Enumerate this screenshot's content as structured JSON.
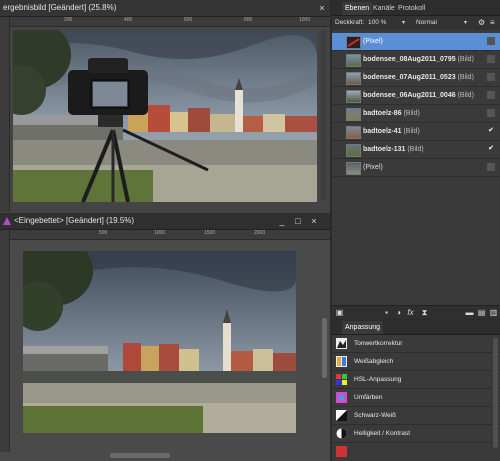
{
  "doc1": {
    "title": "ergebnisbild [Geändert] (25.8%)",
    "ruler_ticks": [
      "200",
      "400",
      "600",
      "800",
      "1000"
    ],
    "close_icon": "close-icon"
  },
  "doc2": {
    "title": "<Eingebettet> [Geändert] (19.5%)",
    "ruler_ticks": [
      "500",
      "1000",
      "1500",
      "2000"
    ],
    "minimize": "_",
    "maximize": "□",
    "close": "×",
    "app_icon": "triangle-icon"
  },
  "layers_panel": {
    "tabs": [
      "Ebenen",
      "Kanäle",
      "Protokoll"
    ],
    "opacity_label": "Deckkraft:",
    "opacity_value": "100 %",
    "blend_mode": "Normal",
    "layers": [
      {
        "name": "",
        "kind": "(Pixel)",
        "selected": true,
        "visible": false
      },
      {
        "name": "bodensee_08Aug2011_0795",
        "kind": " (Bild)",
        "selected": false,
        "visible": false
      },
      {
        "name": "bodensee_07Aug2011_0523",
        "kind": " (Bild)",
        "selected": false,
        "visible": false
      },
      {
        "name": "bodensee_06Aug2011_0046",
        "kind": " (Bild)",
        "selected": false,
        "visible": false
      },
      {
        "name": "badtoelz-86",
        "kind": " (Bild)",
        "selected": false,
        "visible": false
      },
      {
        "name": "badtoelz-41",
        "kind": " (Bild)",
        "selected": false,
        "visible": true
      },
      {
        "name": "badtoelz-131",
        "kind": " (Bild)",
        "selected": false,
        "visible": true
      },
      {
        "name": "",
        "kind": "(Pixel)",
        "selected": false,
        "visible": false
      }
    ]
  },
  "adjust_panel": {
    "tab": "Anpassung",
    "items": [
      {
        "label": "Tonwertkorrektur",
        "icon": "levels-icon"
      },
      {
        "label": "Weißabgleich",
        "icon": "white-balance-icon"
      },
      {
        "label": "HSL-Anpassung",
        "icon": "hsl-icon"
      },
      {
        "label": "Umfärben",
        "icon": "recolor-icon"
      },
      {
        "label": "Schwarz-Weiß",
        "icon": "black-white-icon"
      },
      {
        "label": "Helligkeit / Kontrast",
        "icon": "brightness-contrast-icon"
      }
    ]
  },
  "colors": {
    "selection": "#5a8fd6",
    "panel_bg": "#3a3a3a"
  }
}
